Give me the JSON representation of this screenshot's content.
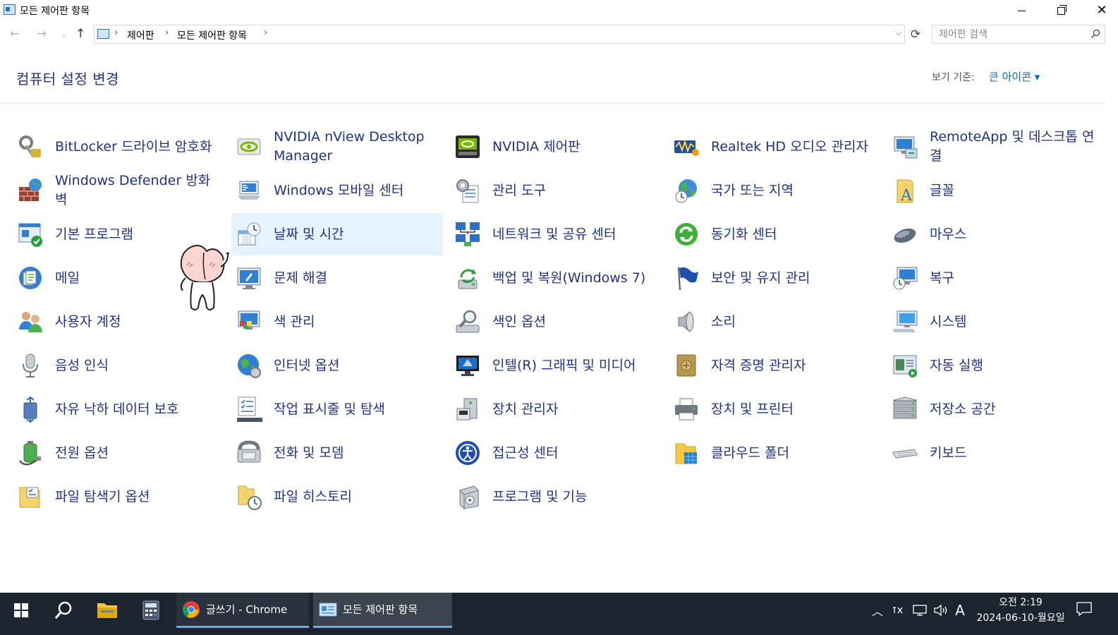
{
  "window": {
    "title": "모든 제어판 항목",
    "controls": {
      "minimize": "minimize",
      "maximize": "restore",
      "close": "close"
    }
  },
  "address": {
    "crumbs": [
      "제어판",
      "모든 제어판 항목"
    ],
    "search_placeholder": "제어판 검색"
  },
  "header": {
    "title": "컴퓨터 설정 변경",
    "view_by_label": "보기 기준:",
    "view_by_value": "큰 아이콘 ▾"
  },
  "items": [
    {
      "label": "BitLocker 드라이브 암호화",
      "icon": "bitlocker-icon"
    },
    {
      "label": "NVIDIA nView Desktop Manager",
      "icon": "nvidia-nview-icon"
    },
    {
      "label": "NVIDIA 제어판",
      "icon": "nvidia-control-panel-icon"
    },
    {
      "label": "Realtek HD 오디오 관리자",
      "icon": "realtek-audio-icon"
    },
    {
      "label": "RemoteApp 및 데스크톱 연결",
      "icon": "remoteapp-icon"
    },
    {
      "label": "Windows Defender 방화벽",
      "icon": "firewall-icon"
    },
    {
      "label": "Windows 모바일 센터",
      "icon": "mobility-center-icon"
    },
    {
      "label": "관리 도구",
      "icon": "admin-tools-icon"
    },
    {
      "label": "국가 또는 지역",
      "icon": "region-icon"
    },
    {
      "label": "글꼴",
      "icon": "fonts-icon"
    },
    {
      "label": "기본 프로그램",
      "icon": "default-programs-icon"
    },
    {
      "label": "날짜 및 시간",
      "icon": "date-time-icon",
      "selected": true
    },
    {
      "label": "네트워크 및 공유 센터",
      "icon": "network-icon"
    },
    {
      "label": "동기화 센터",
      "icon": "sync-center-icon"
    },
    {
      "label": "마우스",
      "icon": "mouse-icon"
    },
    {
      "label": "메일",
      "icon": "mail-icon"
    },
    {
      "label": "문제 해결",
      "icon": "troubleshooting-icon"
    },
    {
      "label": "백업 및 복원(Windows 7)",
      "icon": "backup-icon"
    },
    {
      "label": "보안 및 유지 관리",
      "icon": "security-flag-icon"
    },
    {
      "label": "복구",
      "icon": "recovery-icon"
    },
    {
      "label": "사용자 계정",
      "icon": "user-accounts-icon"
    },
    {
      "label": "색 관리",
      "icon": "color-management-icon"
    },
    {
      "label": "색인 옵션",
      "icon": "indexing-icon"
    },
    {
      "label": "소리",
      "icon": "sound-icon"
    },
    {
      "label": "시스템",
      "icon": "system-icon"
    },
    {
      "label": "음성 인식",
      "icon": "speech-icon"
    },
    {
      "label": "인터넷 옵션",
      "icon": "internet-options-icon"
    },
    {
      "label": "인텔(R) 그래픽 및 미디어",
      "icon": "intel-graphics-icon"
    },
    {
      "label": "자격 증명 관리자",
      "icon": "credential-manager-icon"
    },
    {
      "label": "자동 실행",
      "icon": "autoplay-icon"
    },
    {
      "label": "자유 낙하 데이터 보호",
      "icon": "freefall-icon"
    },
    {
      "label": "작업 표시줄 및 탐색",
      "icon": "taskbar-icon"
    },
    {
      "label": "장치 관리자",
      "icon": "device-manager-icon"
    },
    {
      "label": "장치 및 프린터",
      "icon": "printer-icon"
    },
    {
      "label": "저장소 공간",
      "icon": "storage-spaces-icon"
    },
    {
      "label": "전원 옵션",
      "icon": "power-icon"
    },
    {
      "label": "전화 및 모뎀",
      "icon": "phone-modem-icon"
    },
    {
      "label": "접근성 센터",
      "icon": "ease-of-access-icon"
    },
    {
      "label": "클라우드 폴더",
      "icon": "cloud-folder-icon"
    },
    {
      "label": "키보드",
      "icon": "keyboard-icon"
    },
    {
      "label": "파일 탐색기 옵션",
      "icon": "folder-options-icon"
    },
    {
      "label": "파일 히스토리",
      "icon": "file-history-icon"
    },
    {
      "label": "프로그램 및 기능",
      "icon": "programs-features-icon"
    }
  ],
  "taskbar": {
    "apps": [
      {
        "label": "글쓰기 - Chrome",
        "icon": "chrome-icon"
      },
      {
        "label": "모든 제어판 항목",
        "icon": "control-panel-icon"
      }
    ],
    "ime": "A",
    "clock_time": "오전 2:19",
    "clock_date": "2024-06-10-월요일"
  },
  "colors": {
    "link": "#1e3287",
    "accent": "#0066cc",
    "selection": "#e5f3ff",
    "taskbar": "#1c2430"
  }
}
